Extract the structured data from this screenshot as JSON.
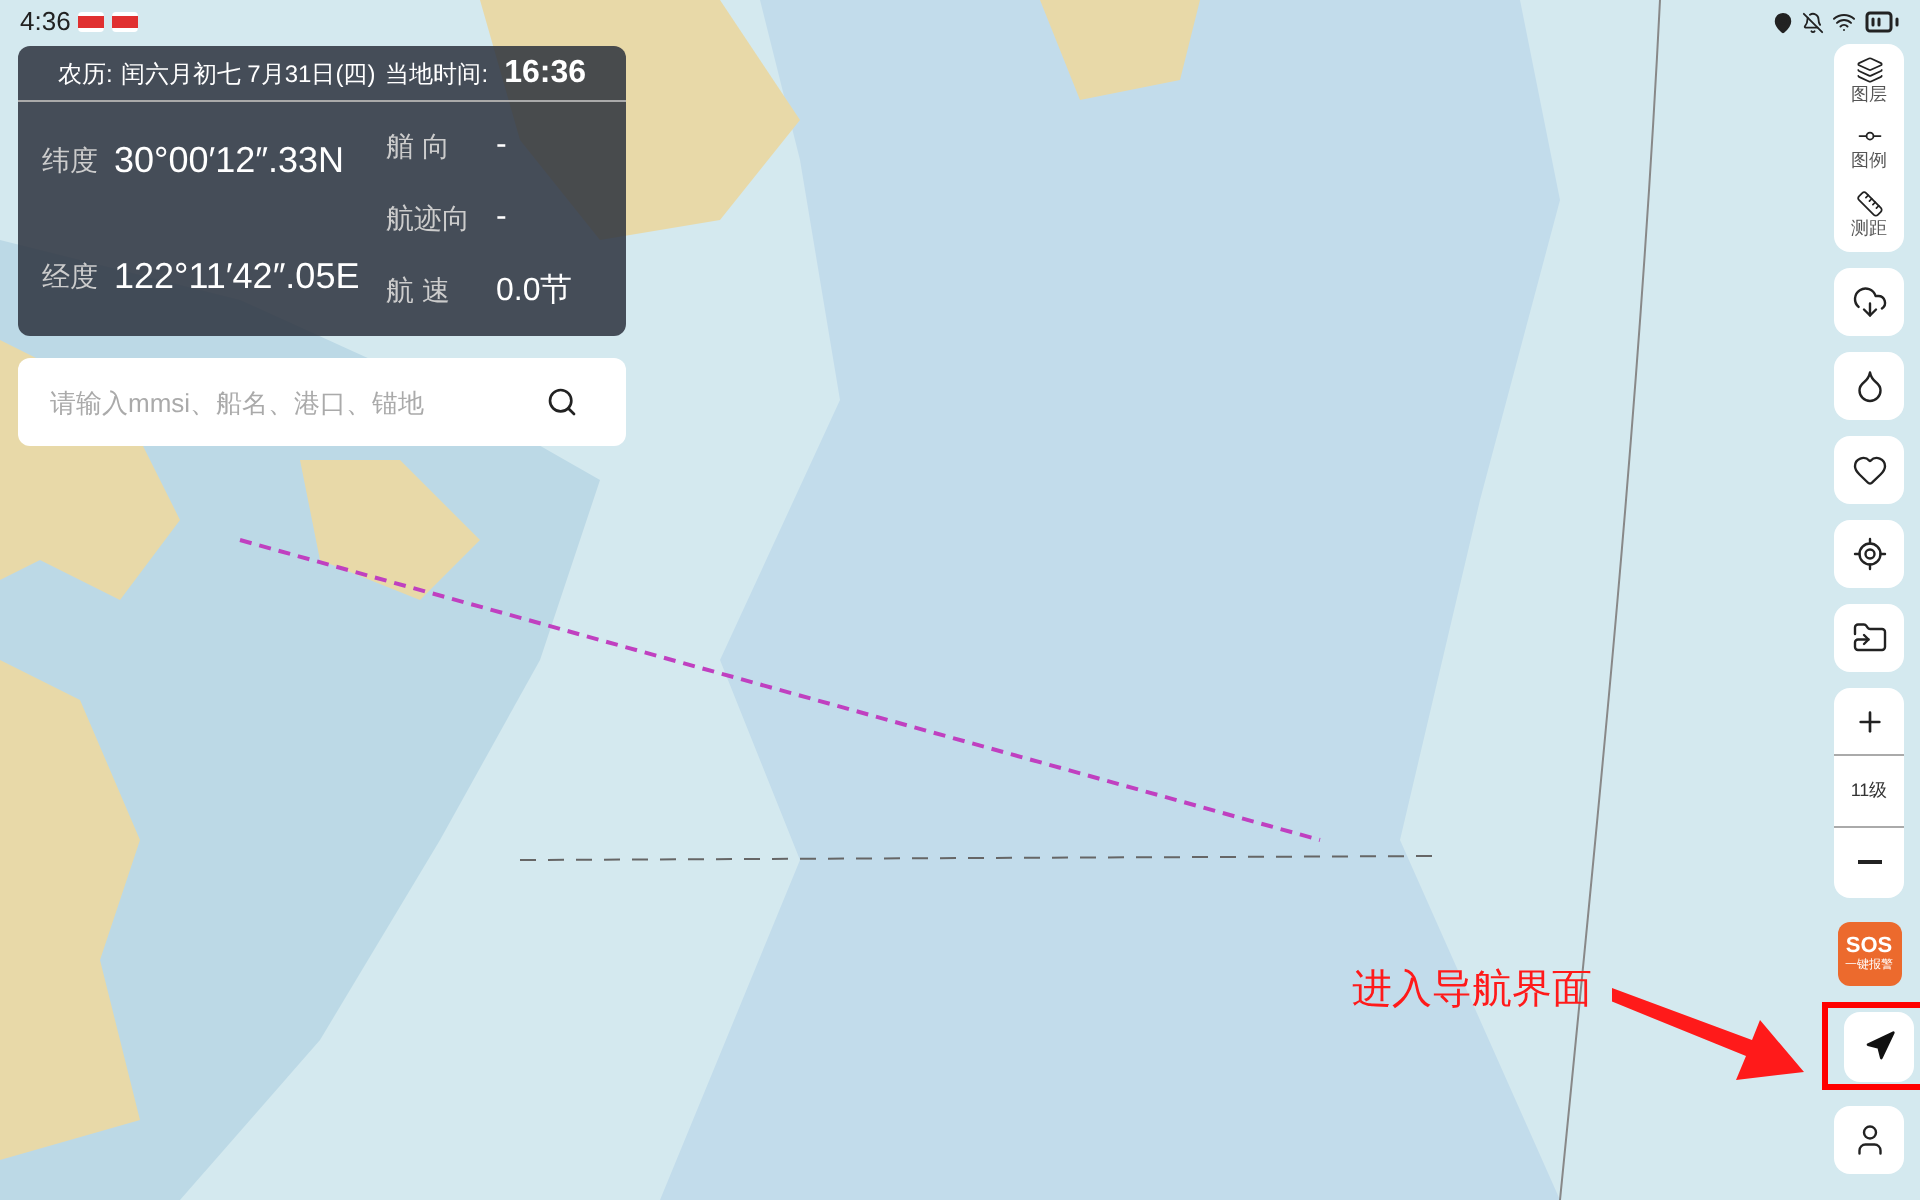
{
  "status_bar": {
    "time": "4:36"
  },
  "info_panel": {
    "lunar_label": "农历:",
    "lunar_date": "闰六月初七 7月31日(四)",
    "local_time_label": "当地时间:",
    "local_time": "16:36",
    "latitude_label": "纬度",
    "latitude": "30°00′12″.33N",
    "longitude_label": "经度",
    "longitude": "122°11′42″.05E",
    "readings": [
      {
        "label": "艏 向",
        "value": "-"
      },
      {
        "label": "航迹向",
        "value": "-"
      },
      {
        "label": "航 速",
        "value": "0.0节"
      }
    ]
  },
  "search": {
    "placeholder": "请输入mmsi、船名、港口、锚地"
  },
  "map_tools": [
    {
      "kind": "layers",
      "label": "图层"
    },
    {
      "kind": "legend",
      "label": "图例"
    },
    {
      "kind": "ruler",
      "label": "测距"
    }
  ],
  "zoom": {
    "level_label": "11级"
  },
  "sos": {
    "title": "SOS",
    "subtitle": "一键报警"
  },
  "annotation": {
    "text": "进入导航界面"
  }
}
